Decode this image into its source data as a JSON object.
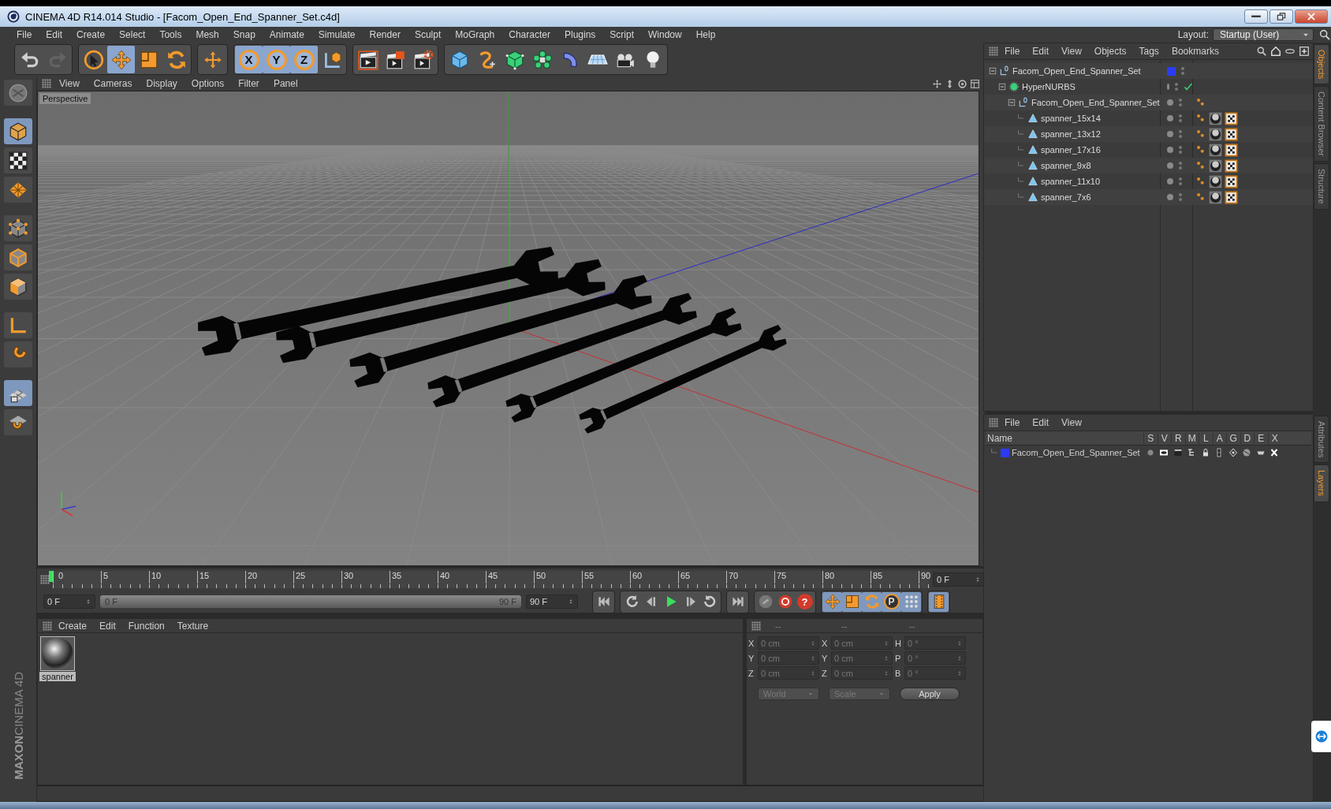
{
  "window": {
    "title": "CINEMA 4D R14.014 Studio - [Facom_Open_End_Spanner_Set.c4d]"
  },
  "menu": [
    "File",
    "Edit",
    "Create",
    "Select",
    "Tools",
    "Mesh",
    "Snap",
    "Animate",
    "Simulate",
    "Render",
    "Sculpt",
    "MoGraph",
    "Character",
    "Plugins",
    "Script",
    "Window",
    "Help"
  ],
  "layout": {
    "label": "Layout:",
    "value": "Startup (User)"
  },
  "toolbar": [
    {
      "items": [
        {
          "kind": "undo",
          "selected": false,
          "disabled": false
        },
        {
          "kind": "redo",
          "selected": false,
          "disabled": true
        }
      ]
    },
    {
      "items": [
        {
          "kind": "select",
          "selected": false,
          "disabled": false
        },
        {
          "kind": "move",
          "selected": true,
          "disabled": false
        },
        {
          "kind": "scale",
          "selected": false,
          "disabled": false
        },
        {
          "kind": "rotate",
          "selected": false,
          "disabled": false
        }
      ]
    },
    {
      "items": [
        {
          "kind": "last-tool",
          "selected": false,
          "disabled": false
        }
      ]
    },
    {
      "items": [
        {
          "kind": "axis-lock",
          "label": "X",
          "selected": true,
          "disabled": false
        },
        {
          "kind": "axis-lock",
          "label": "Y",
          "selected": true,
          "disabled": false
        },
        {
          "kind": "axis-lock",
          "label": "Z",
          "selected": true,
          "disabled": false
        },
        {
          "kind": "coordinate-system",
          "selected": false,
          "disabled": false
        }
      ]
    },
    {
      "items": [
        {
          "kind": "render-view",
          "selected": false,
          "disabled": false
        },
        {
          "kind": "render-picture",
          "selected": false,
          "disabled": false
        },
        {
          "kind": "render-settings",
          "selected": false,
          "disabled": false
        }
      ]
    },
    {
      "items": [
        {
          "kind": "cube",
          "selected": false,
          "disabled": false
        },
        {
          "kind": "spline",
          "selected": false,
          "disabled": false
        },
        {
          "kind": "subdivision",
          "selected": false,
          "disabled": false
        },
        {
          "kind": "array",
          "selected": false,
          "disabled": false
        },
        {
          "kind": "deformer",
          "selected": false,
          "disabled": false
        },
        {
          "kind": "floor",
          "selected": false,
          "disabled": false
        },
        {
          "kind": "camera",
          "selected": false,
          "disabled": false
        },
        {
          "kind": "light",
          "selected": false,
          "disabled": false
        }
      ]
    }
  ],
  "modes": [
    {
      "kind": "model",
      "selected": false
    },
    {
      "kind": "object",
      "selected": true
    },
    {
      "kind": "texture",
      "selected": false
    },
    {
      "kind": "workplane",
      "selected": false
    },
    {
      "kind": "points",
      "selected": false
    },
    {
      "kind": "edges",
      "selected": false
    },
    {
      "kind": "polygons",
      "selected": false
    },
    {
      "kind": "axis",
      "selected": false
    },
    {
      "kind": "magnet",
      "selected": false
    },
    {
      "kind": "snap-grid",
      "selected": true
    },
    {
      "kind": "snap-settings",
      "selected": false
    }
  ],
  "brand": {
    "line_1": "MAXON",
    "line_2": "CINEMA 4D"
  },
  "viewport": {
    "menu": [
      "View",
      "Cameras",
      "Display",
      "Options",
      "Filter",
      "Panel"
    ],
    "camera": "Perspective"
  },
  "objects": {
    "menu": [
      "File",
      "Edit",
      "View",
      "Objects",
      "Tags",
      "Bookmarks"
    ],
    "tree": [
      {
        "name": "Facom_Open_End_Spanner_Set",
        "kind": "null",
        "expanded": true,
        "color": "#2b3cf5",
        "children": [
          {
            "name": "HyperNURBS",
            "kind": "subdivision",
            "expanded": true,
            "enabled": true,
            "children": [
              {
                "name": "Facom_Open_End_Spanner_Set",
                "kind": "null",
                "expanded": true,
                "tags": [
                  {
                    "kind": "phong"
                  }
                ],
                "children": [
                  {
                    "name": "spanner_15x14",
                    "kind": "polygon",
                    "tags": [
                      {
                        "kind": "phong"
                      },
                      {
                        "kind": "material"
                      },
                      {
                        "kind": "uvw"
                      }
                    ]
                  },
                  {
                    "name": "spanner_13x12",
                    "kind": "polygon",
                    "tags": [
                      {
                        "kind": "phong"
                      },
                      {
                        "kind": "material"
                      },
                      {
                        "kind": "uvw"
                      }
                    ]
                  },
                  {
                    "name": "spanner_17x16",
                    "kind": "polygon",
                    "tags": [
                      {
                        "kind": "phong"
                      },
                      {
                        "kind": "material"
                      },
                      {
                        "kind": "uvw"
                      }
                    ]
                  },
                  {
                    "name": "spanner_9x8",
                    "kind": "polygon",
                    "tags": [
                      {
                        "kind": "phong"
                      },
                      {
                        "kind": "material"
                      },
                      {
                        "kind": "uvw"
                      }
                    ]
                  },
                  {
                    "name": "spanner_11x10",
                    "kind": "polygon",
                    "tags": [
                      {
                        "kind": "phong"
                      },
                      {
                        "kind": "material"
                      },
                      {
                        "kind": "uvw"
                      }
                    ]
                  },
                  {
                    "name": "spanner_7x6",
                    "kind": "polygon",
                    "tags": [
                      {
                        "kind": "phong"
                      },
                      {
                        "kind": "material"
                      },
                      {
                        "kind": "uvw"
                      }
                    ]
                  }
                ]
              }
            ]
          }
        ]
      }
    ]
  },
  "side_tabs_top": [
    {
      "label": "Objects",
      "selected": true
    },
    {
      "label": "Content Browser",
      "selected": false
    },
    {
      "label": "Structure",
      "selected": false
    }
  ],
  "layers": {
    "menu": [
      "File",
      "Edit",
      "View"
    ],
    "columns": [
      "Name",
      "S",
      "V",
      "R",
      "M",
      "L",
      "A",
      "G",
      "D",
      "E",
      "X"
    ],
    "rows": [
      {
        "name": "Facom_Open_End_Spanner_Set",
        "color": "#2b3cf5"
      }
    ]
  },
  "side_tabs_bottom": [
    {
      "label": "Attributes",
      "selected": false
    },
    {
      "label": "Layers",
      "selected": true
    }
  ],
  "timeline": {
    "ticks": [
      "0",
      "5",
      "10",
      "15",
      "20",
      "25",
      "30",
      "35",
      "40",
      "45",
      "50",
      "55",
      "60",
      "65",
      "70",
      "75",
      "80",
      "85",
      "90"
    ],
    "current": "0 F",
    "start": "0 F",
    "range": {
      "start": "0 F",
      "end": "90 F",
      "level": 1
    },
    "end": "90 F",
    "groups": [
      {
        "items": [
          {
            "kind": "go-start",
            "selected": false
          }
        ]
      },
      {
        "items": [
          {
            "kind": "prev-key",
            "selected": false
          },
          {
            "kind": "prev-frame",
            "selected": false
          },
          {
            "kind": "play",
            "selected": false
          },
          {
            "kind": "next-frame",
            "selected": false
          },
          {
            "kind": "next-key",
            "selected": false
          }
        ]
      },
      {
        "items": [
          {
            "kind": "go-end",
            "selected": false
          }
        ]
      },
      {
        "items": [
          {
            "kind": "record-motion",
            "selected": false
          },
          {
            "kind": "autokey",
            "selected": false
          },
          {
            "kind": "key-help",
            "label": "?",
            "selected": false
          }
        ]
      },
      {
        "items": [
          {
            "kind": "key-move",
            "selected": true
          },
          {
            "kind": "key-scale",
            "selected": true
          },
          {
            "kind": "key-rotate",
            "selected": true
          },
          {
            "kind": "key-param",
            "label": "P",
            "selected": true
          },
          {
            "kind": "key-points",
            "selected": true
          }
        ]
      },
      {
        "items": [
          {
            "kind": "timeline-window",
            "selected": true
          }
        ]
      }
    ]
  },
  "materials": {
    "menu": [
      "Create",
      "Edit",
      "Function",
      "Texture"
    ],
    "items": [
      {
        "name": "spanner"
      }
    ]
  },
  "coordinates": {
    "headers": [
      "--",
      "--",
      "--"
    ],
    "rows": [
      {
        "cells": [
          {
            "axis": "X",
            "value": "0 cm"
          },
          {
            "axis": "X",
            "value": "0 cm"
          },
          {
            "axis": "H",
            "value": "0 °"
          }
        ]
      },
      {
        "cells": [
          {
            "axis": "Y",
            "value": "0 cm"
          },
          {
            "axis": "Y",
            "value": "0 cm"
          },
          {
            "axis": "P",
            "value": "0 °"
          }
        ]
      },
      {
        "cells": [
          {
            "axis": "Z",
            "value": "0 cm"
          },
          {
            "axis": "Z",
            "value": "0 cm"
          },
          {
            "axis": "B",
            "value": "0 °"
          }
        ]
      }
    ],
    "mode": {
      "value": "World",
      "disabled": true
    },
    "transform": {
      "value": "Scale",
      "disabled": true
    },
    "apply": "Apply"
  }
}
